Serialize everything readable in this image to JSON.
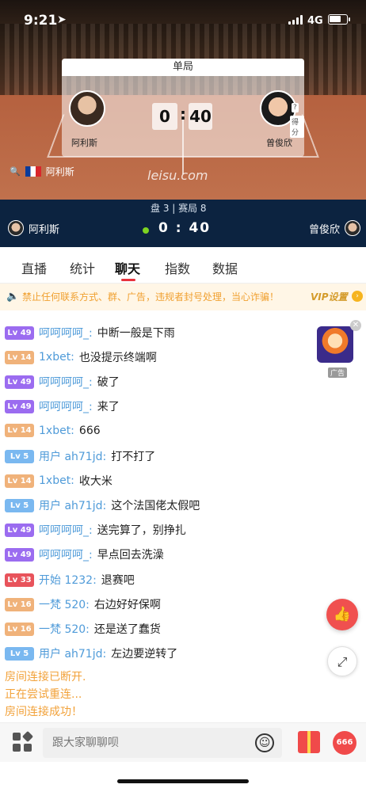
{
  "status_bar": {
    "time": "9:21",
    "network": "4G"
  },
  "scoreboard": {
    "header": "单局",
    "player_left": "阿利斯",
    "player_right": "曾俊欣",
    "score_left": "0",
    "score_right": "40",
    "colon": ":",
    "side_tag_1": "?",
    "side_tag_2": "得分",
    "watermark": "leisu.com",
    "mini_player": "阿利斯"
  },
  "strip": {
    "set_info": "盘 3 | 赛局 8",
    "player_left": "阿利斯",
    "player_right": "曾俊欣",
    "score": "0 : 40"
  },
  "tabs": [
    "直播",
    "统计",
    "聊天",
    "指数",
    "数据"
  ],
  "active_tab": "聊天",
  "notice": {
    "text": "禁止任何联系方式、群、广告，违规者封号处理，当心诈骗！",
    "vip_label": "VIP设置"
  },
  "chat": {
    "messages": [
      {
        "level": "Lv 49",
        "user": "呵呵呵呵_:",
        "text": "中断一般是下雨"
      },
      {
        "level": "Lv 14",
        "user": "1xbet:",
        "text": "也没提示终端啊"
      },
      {
        "level": "Lv 49",
        "user": "呵呵呵呵_:",
        "text": "破了"
      },
      {
        "level": "Lv 49",
        "user": "呵呵呵呵_:",
        "text": "来了"
      },
      {
        "level": "Lv 14",
        "user": "1xbet:",
        "text": "666"
      },
      {
        "level": "Lv 5",
        "user": "用户 ah71jd:",
        "text": "打不打了"
      },
      {
        "level": "Lv 14",
        "user": "1xbet:",
        "text": "收大米"
      },
      {
        "level": "Lv 5",
        "user": "用户 ah71jd:",
        "text": "这个法国佬太假吧"
      },
      {
        "level": "Lv 49",
        "user": "呵呵呵呵_:",
        "text": "送完算了，别挣扎"
      },
      {
        "level": "Lv 49",
        "user": "呵呵呵呵_:",
        "text": "早点回去洗澡"
      },
      {
        "level": "Lv 33",
        "user": "开始 1232:",
        "text": "退赛吧"
      },
      {
        "level": "Lv 16",
        "user": "一梵 520:",
        "text": "右边好好保啊"
      },
      {
        "level": "Lv 16",
        "user": "一梵 520:",
        "text": "还是送了蠢货"
      },
      {
        "level": "Lv 5",
        "user": "用户 ah71jd:",
        "text": "左边要逆转了"
      }
    ],
    "system": [
      "房间连接已断开.",
      "正在尝试重连...",
      "房间连接成功！"
    ]
  },
  "ad": {
    "tag": "广告"
  },
  "input": {
    "placeholder": "跟大家聊聊呗"
  },
  "badge": "666",
  "colors": {
    "lv49": "#9b6cf0",
    "lv14": "#f0b27a",
    "lv5": "#7ab8f0",
    "lv33": "#e8535b",
    "lv16": "#f0b27a",
    "accent": "#e8323c"
  }
}
